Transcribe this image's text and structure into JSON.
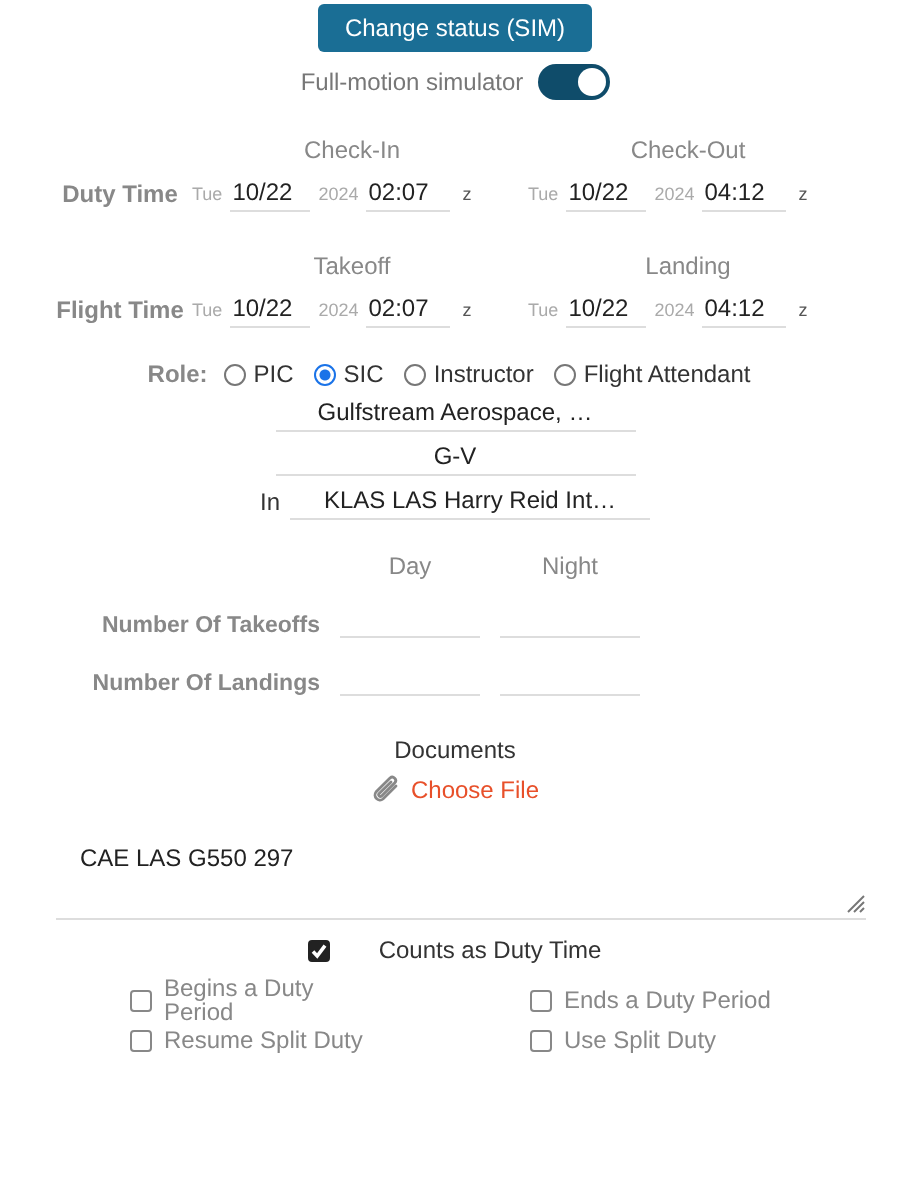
{
  "status_button": {
    "label": "Change status (SIM)"
  },
  "simulator_toggle": {
    "label": "Full-motion simulator",
    "on": true
  },
  "time_sections": [
    {
      "label": "Duty Time",
      "columns": [
        {
          "heading": "Check-In",
          "weekday": "Tue",
          "date": "10/22",
          "year": "2024",
          "time": "02:07",
          "zone": "z"
        },
        {
          "heading": "Check-Out",
          "weekday": "Tue",
          "date": "10/22",
          "year": "2024",
          "time": "04:12",
          "zone": "z"
        }
      ]
    },
    {
      "label": "Flight Time",
      "columns": [
        {
          "heading": "Takeoff",
          "weekday": "Tue",
          "date": "10/22",
          "year": "2024",
          "time": "02:07",
          "zone": "z"
        },
        {
          "heading": "Landing",
          "weekday": "Tue",
          "date": "10/22",
          "year": "2024",
          "time": "04:12",
          "zone": "z"
        }
      ]
    }
  ],
  "role": {
    "label": "Role:",
    "options": [
      {
        "label": "PIC",
        "selected": false
      },
      {
        "label": "SIC",
        "selected": true
      },
      {
        "label": "Instructor",
        "selected": false
      },
      {
        "label": "Flight Attendant",
        "selected": false
      }
    ]
  },
  "aircraft_make": "Gulfstream Aerospace, …",
  "aircraft_model": "G-V",
  "location": {
    "label": "In",
    "value": "KLAS LAS Harry Reid Int…"
  },
  "counts": {
    "columns": [
      "Day",
      "Night"
    ],
    "rows": [
      {
        "label": "Number Of Takeoffs"
      },
      {
        "label": "Number Of Landings"
      }
    ]
  },
  "documents": {
    "heading": "Documents",
    "action": "Choose File"
  },
  "remarks": "CAE LAS G550 297",
  "duty_checkbox": {
    "label": "Counts as Duty Time",
    "checked": true
  },
  "duty_options": [
    {
      "label": "Begins a Duty Period",
      "checked": false
    },
    {
      "label": "Ends a Duty Period",
      "checked": false
    },
    {
      "label": "Resume Split Duty",
      "checked": false
    },
    {
      "label": "Use Split Duty",
      "checked": false
    }
  ]
}
